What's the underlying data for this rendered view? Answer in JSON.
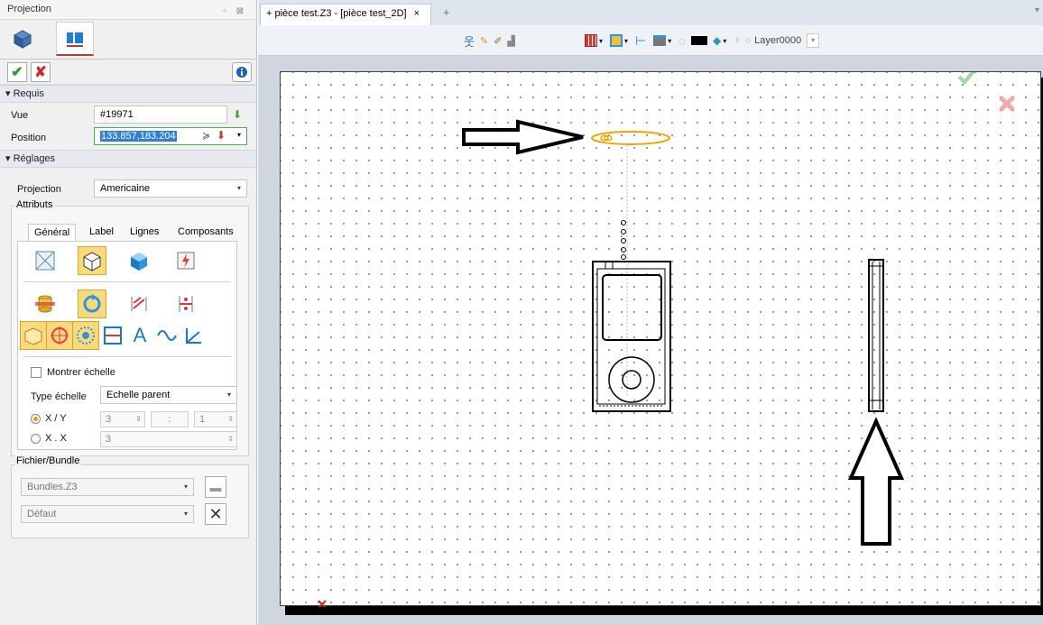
{
  "panel": {
    "title": "Projection",
    "ctrl_glyphs": "▫ ⊠",
    "sections": {
      "requis": "Requis",
      "reglages": "Réglages"
    },
    "vue": {
      "label": "Vue",
      "value": "#19971"
    },
    "position": {
      "label": "Position",
      "value": "133.857,183.204"
    },
    "projection": {
      "label": "Projection",
      "value": "Americaine"
    },
    "attributs": {
      "title": "Attributs",
      "tabs": [
        "Général",
        "Label",
        "Lignes",
        "Composants"
      ],
      "montrer_echelle": "Montrer échelle",
      "type_echelle": {
        "label": "Type échelle",
        "value": "Echelle parent"
      },
      "xy": {
        "label": "X / Y",
        "num": "3",
        "sep": ":",
        "den": "1"
      },
      "xx": {
        "label": "X . X",
        "value": "3"
      }
    },
    "fichier": {
      "title": "Fichier/Bundle",
      "bundle": "Bundles.Z3",
      "defaut": "Défaut"
    }
  },
  "workspace": {
    "tab_label": "+ pièce test.Z3 - [pièce test_2D]",
    "tab_close": "×",
    "tab_add": "+",
    "layer": "Layer0000"
  },
  "colors": {
    "accent_orange": "#f0a500",
    "ok_green": "#2e9a2e",
    "cancel_red": "#d22727"
  }
}
